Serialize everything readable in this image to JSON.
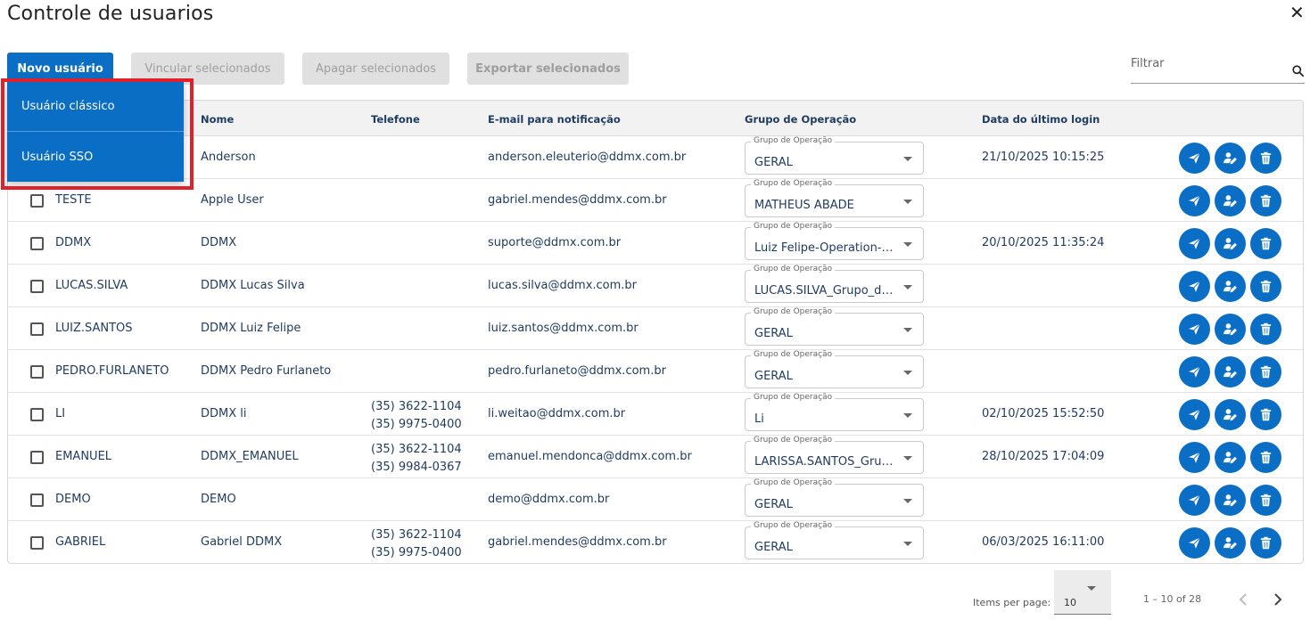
{
  "header": {
    "title": "Controle de usuarios",
    "close_glyph": "✕"
  },
  "toolbar": {
    "new_user": "Novo usuário",
    "link_selected": "Vincular selecionados",
    "delete_selected": "Apagar selecionados",
    "export_selected": "Exportar selecionados"
  },
  "filter": {
    "label": "Filtrar",
    "icon": "search-icon"
  },
  "dropdown_menu": {
    "items": [
      "Usuário clássico",
      "Usuário SSO"
    ]
  },
  "table": {
    "columns": [
      "Nome",
      "Telefone",
      "E-mail para notificação",
      "Grupo de Operação",
      "Data do último login"
    ],
    "select_label": "Grupo de Operação",
    "rows": [
      {
        "login": "",
        "name": "Anderson",
        "phone1": "",
        "phone2": "",
        "email": "anderson.eleuterio@ddmx.com.br",
        "group": "GERAL",
        "last_login": "21/10/2025 10:15:25"
      },
      {
        "login": "TESTE",
        "name": "Apple User",
        "phone1": "",
        "phone2": "",
        "email": "gabriel.mendes@ddmx.com.br",
        "group": "MATHEUS ABADE",
        "last_login": ""
      },
      {
        "login": "DDMX",
        "name": "DDMX",
        "phone1": "",
        "phone2": "",
        "email": "suporte@ddmx.com.br",
        "group": "Luiz Felipe-Operation-…",
        "last_login": "20/10/2025 11:35:24"
      },
      {
        "login": "LUCAS.SILVA",
        "name": "DDMX Lucas Silva",
        "phone1": "",
        "phone2": "",
        "email": "lucas.silva@ddmx.com.br",
        "group": "LUCAS.SILVA_Grupo_de…",
        "last_login": ""
      },
      {
        "login": "LUIZ.SANTOS",
        "name": "DDMX Luiz Felipe",
        "phone1": "",
        "phone2": "",
        "email": "luiz.santos@ddmx.com.br",
        "group": "GERAL",
        "last_login": ""
      },
      {
        "login": "PEDRO.FURLANETO",
        "name": "DDMX Pedro Furlaneto",
        "phone1": "",
        "phone2": "",
        "email": "pedro.furlaneto@ddmx.com.br",
        "group": "GERAL",
        "last_login": ""
      },
      {
        "login": "LI",
        "name": "DDMX li",
        "phone1": "(35) 3622-1104",
        "phone2": "(35) 9975-0400",
        "email": "li.weitao@ddmx.com.br",
        "group": "Li",
        "last_login": "02/10/2025 15:52:50"
      },
      {
        "login": "EMANUEL",
        "name": "DDMX_EMANUEL",
        "phone1": "(35) 3622-1104",
        "phone2": "(35) 9984-0367",
        "email": "emanuel.mendonca@ddmx.com.br",
        "group": "LARISSA.SANTOS_Grup…",
        "last_login": "28/10/2025 17:04:09"
      },
      {
        "login": "DEMO",
        "name": "DEMO",
        "phone1": "",
        "phone2": "",
        "email": "demo@ddmx.com.br",
        "group": "GERAL",
        "last_login": ""
      },
      {
        "login": "GABRIEL",
        "name": "Gabriel DDMX",
        "phone1": "(35) 3622-1104",
        "phone2": "(35) 9975-0400",
        "email": "gabriel.mendes@ddmx.com.br",
        "group": "GERAL",
        "last_login": "06/03/2025 16:11:00"
      }
    ],
    "row_actions": [
      "send-icon",
      "edit-user-icon",
      "trash-icon"
    ]
  },
  "pagination": {
    "items_per_page_label": "Items per page:",
    "items_per_page": "10",
    "range": "1 – 10 of 28"
  },
  "colors": {
    "primary": "#0b6ec5",
    "highlight": "#e0202b",
    "text": "#1f3a5f"
  }
}
